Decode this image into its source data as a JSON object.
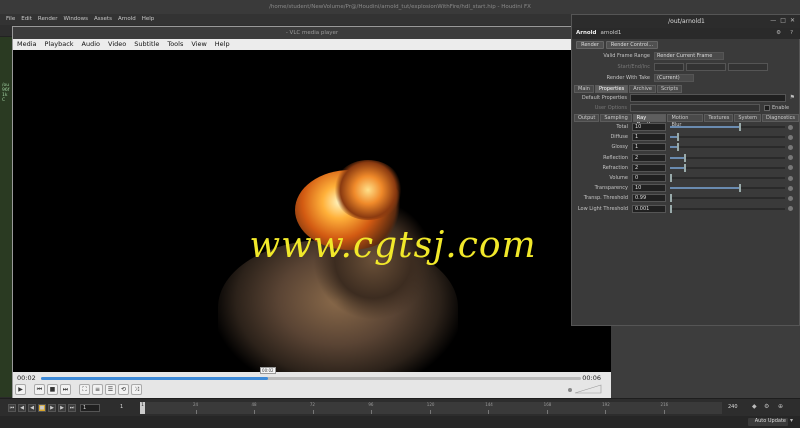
{
  "houdini": {
    "title": "/home/student/NewVolume/Pr@/Houdini/arnold_tut/explosionWithFire/hdl_start.hip - Houdini FX",
    "menu": [
      "File",
      "Edit",
      "Render",
      "Windows",
      "Assets",
      "Arnold",
      "Help"
    ],
    "left_strip": [
      "/ou",
      "96f",
      "1k",
      "C"
    ]
  },
  "vlc": {
    "title": "- VLC media player",
    "menu": [
      "Media",
      "Playback",
      "Audio",
      "Video",
      "Subtitle",
      "Tools",
      "View",
      "Help"
    ],
    "watermark": "www.cgtsj.com",
    "time_elapsed": "00:02",
    "time_total": "00:06",
    "seek_fraction": 0.42,
    "seek_tooltip": "00:02",
    "controls": {
      "play": "▶",
      "prev": "⏮",
      "stop": "■",
      "next": "⏭",
      "fullscreen": "⛶",
      "extended": "≡",
      "playlist": "☰",
      "loop": "⟲",
      "random": "⤨"
    },
    "volume_fraction": 0.0
  },
  "arnold": {
    "title": "/out/arnold1",
    "node_type": "Arnold",
    "node_name": "arnold1",
    "render_button": "Render",
    "render_control_button": "Render Control...",
    "valid_frame_range_label": "Valid Frame Range",
    "valid_frame_range_value": "Render Current Frame",
    "start_end_inc_label": "Start/End/Inc",
    "render_with_take_label": "Render With Take",
    "render_with_take_value": "(Current)",
    "main_tabs": [
      "Main",
      "Properties",
      "Archive",
      "Scripts"
    ],
    "active_main_tab": "Properties",
    "default_properties_label": "Default Properties",
    "user_options_label": "User Options",
    "enable_label": "Enable",
    "sub_tabs": [
      "Output",
      "Sampling",
      "Ray Depth",
      "Motion Blur",
      "Textures",
      "System",
      "Diagnostics"
    ],
    "active_sub_tab": "Ray Depth",
    "params": [
      {
        "label": "Total",
        "value": "10",
        "fraction": 0.6
      },
      {
        "label": "Diffuse",
        "value": "1",
        "fraction": 0.06
      },
      {
        "label": "Glossy",
        "value": "1",
        "fraction": 0.06
      },
      {
        "label": "Reflection",
        "value": "2",
        "fraction": 0.12
      },
      {
        "label": "Refraction",
        "value": "2",
        "fraction": 0.12
      },
      {
        "label": "Volume",
        "value": "0",
        "fraction": 0.0
      },
      {
        "label": "Transparency",
        "value": "10",
        "fraction": 0.6
      },
      {
        "label": "Transp. Threshold",
        "value": "0.99",
        "fraction": 0.0
      },
      {
        "label": "Low Light Threshold",
        "value": "0.001",
        "fraction": 0.0
      }
    ]
  },
  "timeline": {
    "current_frame": "1",
    "start_frame": "1",
    "end_frame": "1",
    "end_range": "240",
    "ruler_start": "1",
    "ticks": [
      "24",
      "48",
      "72",
      "96",
      "120",
      "144",
      "168",
      "192",
      "216"
    ],
    "auto_update": "Auto Update"
  }
}
